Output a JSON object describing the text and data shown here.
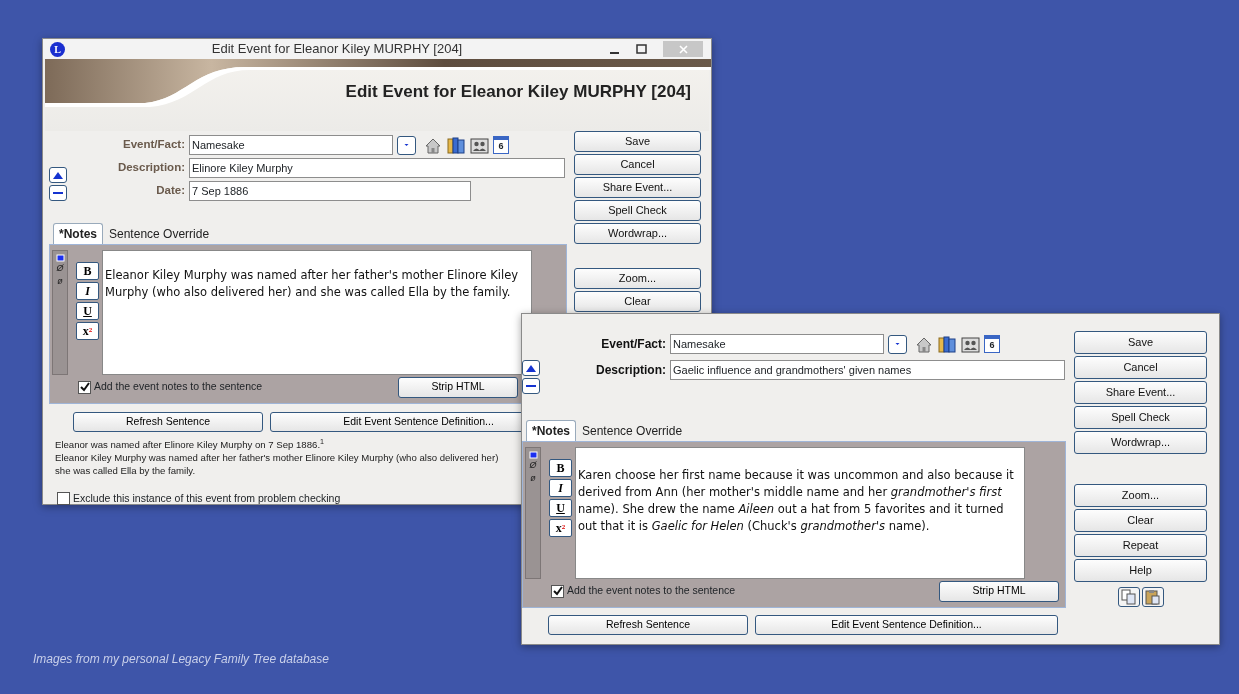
{
  "caption": "Images from my personal Legacy Family Tree database",
  "windows": [
    {
      "app_icon": "L",
      "title": "Edit Event for Eleanor Kiley MURPHY [204]",
      "heading": "Edit Event for Eleanor Kiley MURPHY [204]",
      "fields": [
        {
          "label": "Event/Fact:",
          "value": "Namesake",
          "kind": "combo",
          "calendar_day": "6"
        },
        {
          "label": "Description:",
          "value": "Elinore Kiley Murphy",
          "kind": "long"
        },
        {
          "label": "Date:",
          "value": "7 Sep 1886",
          "kind": "short"
        }
      ],
      "tabs": [
        {
          "label": "*Notes",
          "selected": true
        },
        {
          "label": "Sentence Override",
          "selected": false
        }
      ],
      "strip_marks": [
        "Ø",
        "ø"
      ],
      "format_buttons": [
        "B",
        "I",
        "U",
        "x$^{2}$"
      ],
      "notes": "Eleanor Kiley Murphy was named after her father's mother Elinore Kiley Murphy (who also delivered her) and she was called Ella by the family.",
      "add_notes": {
        "label": "Add the event notes to the sentence",
        "checked": true
      },
      "strip_button": "Strip HTML",
      "sentence_buttons": [
        "Refresh Sentence",
        "Edit Event Sentence Definition..."
      ],
      "sentence": [
        "Eleanor was named after Elinore Kiley Murphy on 7 Sep 1886.$^{1}$",
        "Eleanor Kiley Murphy was named after her father's mother Elinore Kiley Murphy (who also delivered her)",
        "she was called Ella by the family."
      ],
      "exclude": {
        "label": "Exclude this instance of this event from problem checking",
        "checked": false
      },
      "side_buttons": [
        [
          "Save",
          "Cancel",
          "Share Event...",
          "Spell Check",
          "Wordwrap..."
        ],
        [
          "Zoom...",
          "Clear"
        ]
      ]
    },
    {
      "fields": [
        {
          "label": "Event/Fact:",
          "value": "Namesake",
          "kind": "combo",
          "calendar_day": "6"
        },
        {
          "label": "Description:",
          "value": "Gaelic influence and grandmothers' given names",
          "kind": "long"
        }
      ],
      "tabs": [
        {
          "label": "*Notes",
          "selected": true
        },
        {
          "label": "Sentence Override",
          "selected": false
        }
      ],
      "strip_marks": [
        "Ø",
        "ø"
      ],
      "format_buttons": [
        "B",
        "I",
        "U",
        "x$^{2}$"
      ],
      "notes": "Karen choose her first name because it was uncommon and also because it derived from Ann (her mother's middle name and her *grandmother's first* name).  She drew the name *Aileen* out a hat from 5 favorites and it turned out that it is *Gaelic for Helen* (Chuck's *grandmother's* name).",
      "add_notes": {
        "label": "Add the event notes to the sentence",
        "checked": true
      },
      "strip_button": "Strip HTML",
      "sentence_buttons": [
        "Refresh Sentence",
        "Edit Event Sentence Definition..."
      ],
      "side_buttons": [
        [
          "Save",
          "Cancel",
          "Share Event...",
          "Spell Check",
          "Wordwrap..."
        ],
        [
          "Zoom...",
          "Clear",
          "Repeat",
          "Help"
        ]
      ],
      "clipboard_buttons": true
    }
  ]
}
